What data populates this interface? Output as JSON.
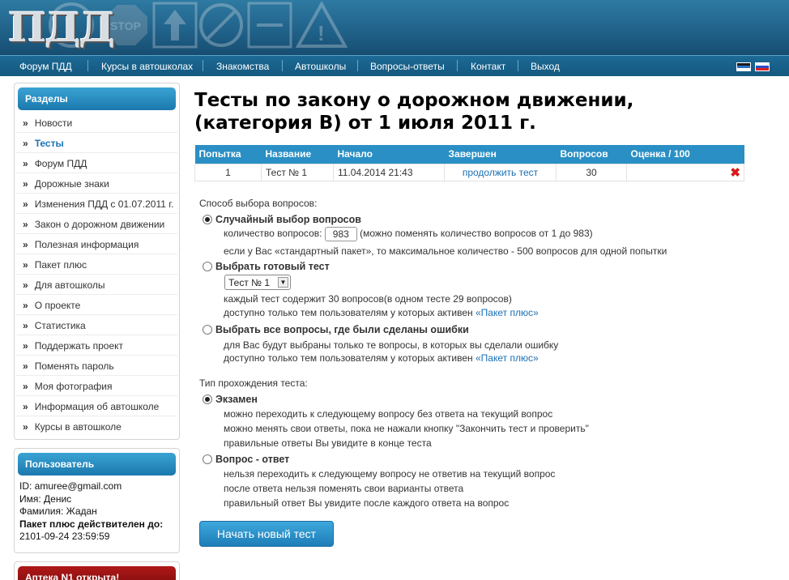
{
  "header": {
    "logo": "ПДД"
  },
  "nav": {
    "items": [
      "Форум ПДД",
      "Курсы в автошколах",
      "Знакомства",
      "Автошколы",
      "Вопросы-ответы",
      "Контакт",
      "Выход"
    ]
  },
  "sidebar": {
    "sections_title": "Разделы",
    "items": [
      {
        "label": "Новости"
      },
      {
        "label": "Тесты"
      },
      {
        "label": "Форум ПДД"
      },
      {
        "label": "Дорожные знаки"
      },
      {
        "label": "Изменения ПДД с 01.07.2011 г."
      },
      {
        "label": "Закон о дорожном движении"
      },
      {
        "label": "Полезная информация"
      },
      {
        "label": "Пакет плюс"
      },
      {
        "label": "Для автошколы"
      },
      {
        "label": "О проекте"
      },
      {
        "label": "Статистика"
      },
      {
        "label": "Поддержать проект"
      },
      {
        "label": "Поменять пароль"
      },
      {
        "label": "Моя фотография"
      },
      {
        "label": "Информация об автошколе"
      },
      {
        "label": "Курсы в автошколе"
      }
    ],
    "bullet": "»",
    "user_title": "Пользователь",
    "user_lines": [
      "ID: amuree@gmail.com",
      "Имя: Денис",
      "Фамилия: Жадан"
    ],
    "package_label": "Пакет плюс действителен до:",
    "package_date": "2101-09-24 23:59:59",
    "pharmacy_title": "Аптека N1 открыта!"
  },
  "main": {
    "title_line1": "Тесты по закону о дорожном движении,",
    "title_line2": "(категория B) от 1 июля 2011 г.",
    "table": {
      "headers": [
        "Попытка",
        "Название",
        "Начало",
        "Завершен",
        "Вопросов",
        "Оценка / 100"
      ],
      "rows": [
        {
          "attempt": "1",
          "name": "Тест № 1",
          "start": "11.04.2014 21:43",
          "finished": "продолжить тест",
          "questions": "30",
          "score": ""
        }
      ]
    },
    "selection_title": "Способ выбора вопросов:",
    "opt_random": "Случайный выбор вопросов",
    "qty_label": "количество вопросов:",
    "qty_value": "983",
    "qty_note": "(можно поменять количество вопросов от 1 до 983)",
    "std_note": "если у Вас «стандартный пакет», то максимальное количество - 500 вопросов для одной попытки",
    "opt_ready": "Выбрать готовый тест",
    "ready_select": "Тест № 1",
    "ready_note1": "каждый тест содержит 30 вопросов(в одном тесте 29 вопросов)",
    "ready_note2": "доступно только тем пользователям у которых активен",
    "package_link": "«Пакет плюс»",
    "opt_mistakes": "Выбрать все вопросы, где были сделаны ошибки",
    "mist_note1": "для Вас будут выбраны только те вопросы, в которых вы сделали ошибку",
    "mist_note2": "доступно только тем пользователям у которых активен",
    "mode_title": "Тип прохождения теста:",
    "opt_exam": "Экзамен",
    "exam_note1": "можно переходить к следующему вопросу без ответа на текущий вопрос",
    "exam_note2": "можно менять свои ответы, пока не нажали кнопку \"Закончить тест и проверить\"",
    "exam_note3": "правильные ответы Вы увидите в конце теста",
    "opt_qa": "Вопрос - ответ",
    "qa_note1": "нельзя переходить к следующему вопросу не ответив на текущий вопрос",
    "qa_note2": "после ответа нельзя поменять свои варианты ответа",
    "qa_note3": "правильный ответ Вы увидите после каждого ответа на вопрос",
    "start_button": "Начать новый тест"
  }
}
